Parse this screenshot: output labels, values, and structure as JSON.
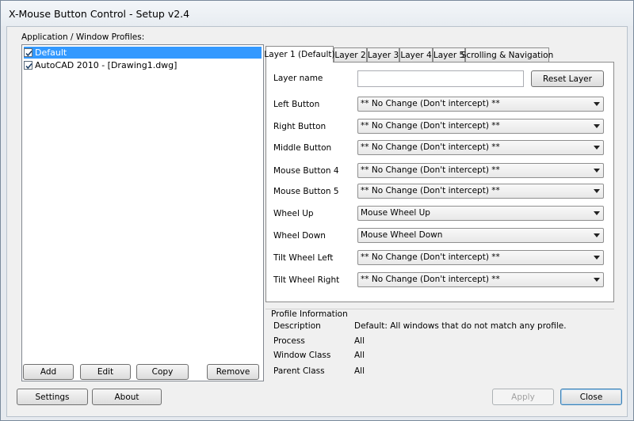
{
  "window": {
    "title": "X-Mouse Button Control - Setup v2.4"
  },
  "profiles": {
    "label": "Application / Window Profiles:",
    "items": [
      {
        "label": "Default",
        "checked": true,
        "selected": true
      },
      {
        "label": "AutoCAD 2010 - [Drawing1.dwg]",
        "checked": true,
        "selected": false
      }
    ],
    "buttons": {
      "add": "Add",
      "edit": "Edit",
      "copy": "Copy",
      "remove": "Remove"
    }
  },
  "tabs": [
    {
      "label": "Layer 1 (Default)",
      "active": true
    },
    {
      "label": "Layer 2"
    },
    {
      "label": "Layer 3"
    },
    {
      "label": "Layer 4"
    },
    {
      "label": "Layer 5"
    },
    {
      "label": "Scrolling & Navigation"
    }
  ],
  "layer": {
    "name_label": "Layer name",
    "name_value": "",
    "reset_label": "Reset Layer",
    "mappings": [
      {
        "label": "Left Button",
        "value": "** No Change (Don't intercept) **"
      },
      {
        "label": "Right Button",
        "value": "** No Change (Don't intercept) **"
      },
      {
        "label": "Middle Button",
        "value": "** No Change (Don't intercept) **"
      },
      {
        "label": "Mouse Button 4",
        "value": "** No Change (Don't intercept) **"
      },
      {
        "label": "Mouse Button 5",
        "value": "** No Change (Don't intercept) **"
      },
      {
        "label": "Wheel Up",
        "value": "Mouse Wheel Up"
      },
      {
        "label": "Wheel Down",
        "value": "Mouse Wheel Down"
      },
      {
        "label": "Tilt Wheel Left",
        "value": "** No Change (Don't intercept) **"
      },
      {
        "label": "Tilt Wheel Right",
        "value": "** No Change (Don't intercept) **"
      }
    ]
  },
  "profile_info": {
    "title": "Profile Information",
    "rows": [
      {
        "label": "Description",
        "value": "Default: All windows that do not match any profile."
      },
      {
        "label": "Process",
        "value": "All"
      },
      {
        "label": "Window Class",
        "value": "All"
      },
      {
        "label": "Parent Class",
        "value": "All"
      }
    ]
  },
  "footer": {
    "settings": "Settings",
    "about": "About",
    "apply": "Apply",
    "close": "Close"
  },
  "colors": {
    "selection": "#3399ff",
    "window_bg": "#f0f0f0",
    "border": "#8c8c8c"
  }
}
